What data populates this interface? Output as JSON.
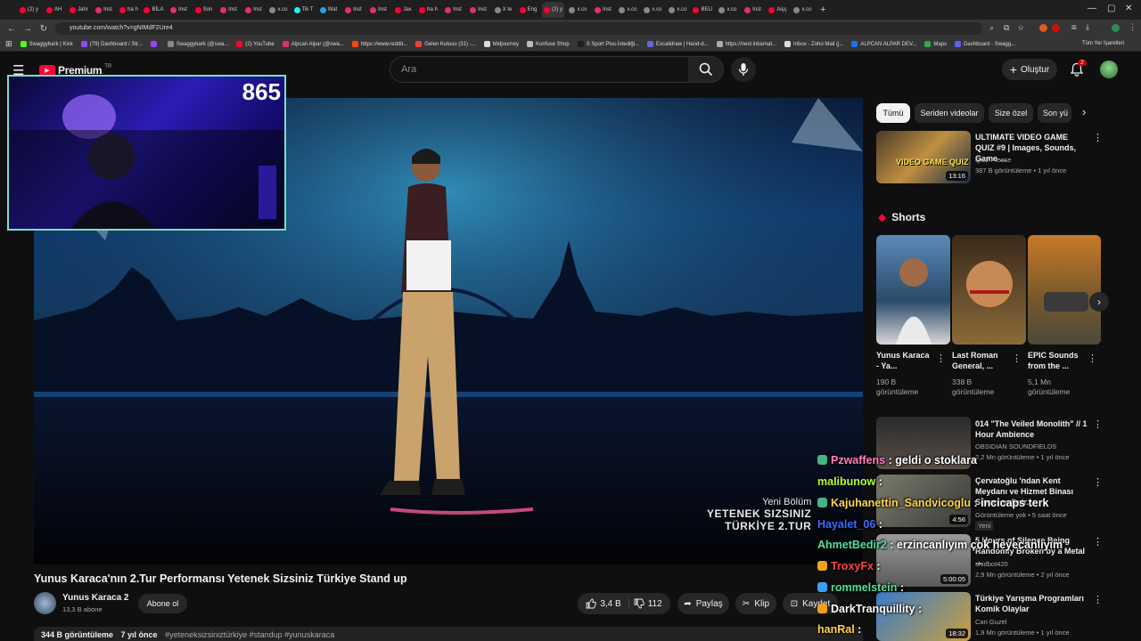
{
  "browser": {
    "tabs": [
      {
        "label": "(2) y",
        "color": "#ff0033"
      },
      {
        "label": "AH",
        "color": "#ff0033"
      },
      {
        "label": "Jahr",
        "color": "#ff0033"
      },
      {
        "label": "Inst",
        "color": "#e1306c"
      },
      {
        "label": "ha h",
        "color": "#ff0033"
      },
      {
        "label": "BİLA",
        "color": "#ff0033"
      },
      {
        "label": "Inst",
        "color": "#e1306c"
      },
      {
        "label": "Son",
        "color": "#ff0033"
      },
      {
        "label": "Inst",
        "color": "#e1306c"
      },
      {
        "label": "Inst",
        "color": "#e1306c"
      },
      {
        "label": "x.co",
        "color": "#888888"
      },
      {
        "label": "Tik T",
        "color": "#25f4ee"
      },
      {
        "label": "Wat",
        "color": "#1da1f2"
      },
      {
        "label": "Inst",
        "color": "#e1306c"
      },
      {
        "label": "Inst",
        "color": "#e1306c"
      },
      {
        "label": "Jax",
        "color": "#ff0033"
      },
      {
        "label": "ha h",
        "color": "#ff0033"
      },
      {
        "label": "Inst",
        "color": "#e1306c"
      },
      {
        "label": "Inst",
        "color": "#e1306c"
      },
      {
        "label": "X te",
        "color": "#888888"
      },
      {
        "label": "Eng",
        "color": "#ff0033"
      },
      {
        "label": "(2) y",
        "color": "#ff0033",
        "active": true
      },
      {
        "label": "x.co",
        "color": "#888888"
      },
      {
        "label": "Inst",
        "color": "#e1306c"
      },
      {
        "label": "x.co",
        "color": "#888888"
      },
      {
        "label": "x.co",
        "color": "#888888"
      },
      {
        "label": "x.co",
        "color": "#888888"
      },
      {
        "label": "BELI",
        "color": "#ff0033"
      },
      {
        "label": "x.co",
        "color": "#888888"
      },
      {
        "label": "Inst",
        "color": "#e1306c"
      },
      {
        "label": "Aişç",
        "color": "#ff0033"
      },
      {
        "label": "x.co",
        "color": "#888888"
      }
    ],
    "new_tab": "+",
    "url": "youtube.com/watch?v=gNIMdF2Ure4",
    "bookmarks": [
      {
        "label": "Swaggybark | Kick",
        "color": "#53fc18"
      },
      {
        "label": "(79) Dashboard / Str...",
        "color": "#9146ff"
      },
      {
        "label": "",
        "color": "#9146ff"
      },
      {
        "label": "Swaggybark (@swa...",
        "color": "#888888"
      },
      {
        "label": "(2) YouTube",
        "color": "#ff0033"
      },
      {
        "label": "Alpcan Alpar (@swa...",
        "color": "#e1306c"
      },
      {
        "label": "https://www.reddit...",
        "color": "#ff4500"
      },
      {
        "label": "Gelen Kutusu (31) -...",
        "color": "#ea4335"
      },
      {
        "label": "Midjourney",
        "color": "#dddddd"
      },
      {
        "label": "Konfuse Shop",
        "color": "#bbbbbb"
      },
      {
        "label": "S Sport Plus-İstediği...",
        "color": "#1e1e1e"
      },
      {
        "label": "Excalidraw | Hand-d...",
        "color": "#6965db"
      },
      {
        "label": "https://next.inkarnat...",
        "color": "#aaaaaa"
      },
      {
        "label": "Inbox - Zoho Mail (j...",
        "color": "#dddddd"
      },
      {
        "label": "ALPCAN ALPAR DEV...",
        "color": "#1a73e8"
      },
      {
        "label": "Maps",
        "color": "#34a853"
      },
      {
        "label": "Dashboard - Swagg...",
        "color": "#5865f2"
      }
    ],
    "bookmarks_all": "Tüm Yer İşaretleri"
  },
  "youtube": {
    "logo": "Premium",
    "logo_sup": "TR",
    "search_placeholder": "Ara",
    "create_label": "Oluştur",
    "notifications_count": "2",
    "video": {
      "overlay_line1": "Yeni Bölüm",
      "overlay_line2": "YETENEK SIZSINIZ",
      "overlay_line3": "TÜRKİYE  2.TUR",
      "title": "Yunus Karaca'nın 2.Tur Performansı Yetenek Sizsiniz Türkiye Stand up",
      "channel": "Yunus Karaca 2",
      "subscribers": "13,3 B abone",
      "subscribe_label": "Abone ol",
      "likes": "3,4 B",
      "dislikes": "112",
      "share": "Paylaş",
      "clip": "Klip",
      "save": "Kaydet",
      "views": "344 B görüntüleme",
      "age": "7 yıl önce",
      "hashtags": "#yeteneksizsiniztürkiye #standup #yunuskaraca"
    },
    "webcam_counter": "865",
    "filters": [
      "Tümü",
      "Seriden videolar",
      "Size özel",
      "Son yü"
    ],
    "rec1": {
      "title": "ULTIMATE VIDEO GAME QUIZ #9 | Images, Sounds, Game ...",
      "channel": "Quiz Please",
      "meta": "387 B görüntüleme • 1 yıl önce",
      "duration": "13:16",
      "thumb_text": "VIDEO GAME QUIZ"
    },
    "shorts_title": "Shorts",
    "shorts": [
      {
        "title": "Yunus Karaca - Ya...",
        "views": "190 B görüntüleme"
      },
      {
        "title": "Last Roman General, ...",
        "views": "338 B görüntüleme"
      },
      {
        "title": "EPIC Sounds from the ...",
        "views": "5,1 Mn görüntüleme"
      }
    ],
    "recs": [
      {
        "title": "014 \"The Veiled Monolith\" // 1 Hour Ambience",
        "channel": "OBSIDIAN SOUNDFIELDS",
        "meta": "2,2 Mn görüntüleme • 1 yıl önce",
        "duration": ""
      },
      {
        "title": "Çervatoğlu 'ndan Kent Meydanı ve Hizmet Binası Sürecine Dair...",
        "channel": "",
        "meta": "Görüntüleme yok • 5 saat önce",
        "badge": "Yeni",
        "duration": "4:56"
      },
      {
        "title": "5 Hours of Silence Being Randomly Broken by a Metal ...",
        "channel": "shidbot420",
        "meta": "2,9 Mn görüntüleme • 2 yıl önce",
        "duration": "5:00:05"
      },
      {
        "title": "Türkiye Yarışma Programları Komik Olaylar",
        "channel": "Can Guzel",
        "meta": "1,9 Mn görüntüleme • 1 yıl önce",
        "duration": "18:32"
      }
    ]
  },
  "chat": [
    {
      "user": "Pzwaffens",
      "user_color": "#ff7fbf",
      "badge_color": "#43b581",
      "msg": "geldi o stoklara"
    },
    {
      "user": "malibunow",
      "user_color": "#b3ff3a",
      "badge_color": "",
      "msg": ""
    },
    {
      "user": "Kajuhanettin_Sandvicoglu",
      "user_color": "#ffd34a",
      "badge_color": "#43b581",
      "msg": "incicaps terk"
    },
    {
      "user": "Hayalet_06",
      "user_color": "#3a6bff",
      "badge_color": "",
      "msg": ""
    },
    {
      "user": "AhmetBedir2",
      "user_color": "#4ee0a0",
      "badge_color": "",
      "msg": "erzincanlıyım çok heyecanlıyım"
    },
    {
      "user": "TroxyFx",
      "user_color": "#ff4545",
      "badge_color": "#f0a020",
      "msg": ""
    },
    {
      "user": "rommelstein",
      "user_color": "#4ee0a0",
      "badge_color": "#3aa0ff",
      "msg": ""
    },
    {
      "user": "DarkTranquillity",
      "user_color": "#ffffff",
      "badge_color": "#f0a020",
      "msg": ""
    },
    {
      "user": "hanRal",
      "user_color": "#ffd34a",
      "badge_color": "",
      "msg": ""
    }
  ]
}
